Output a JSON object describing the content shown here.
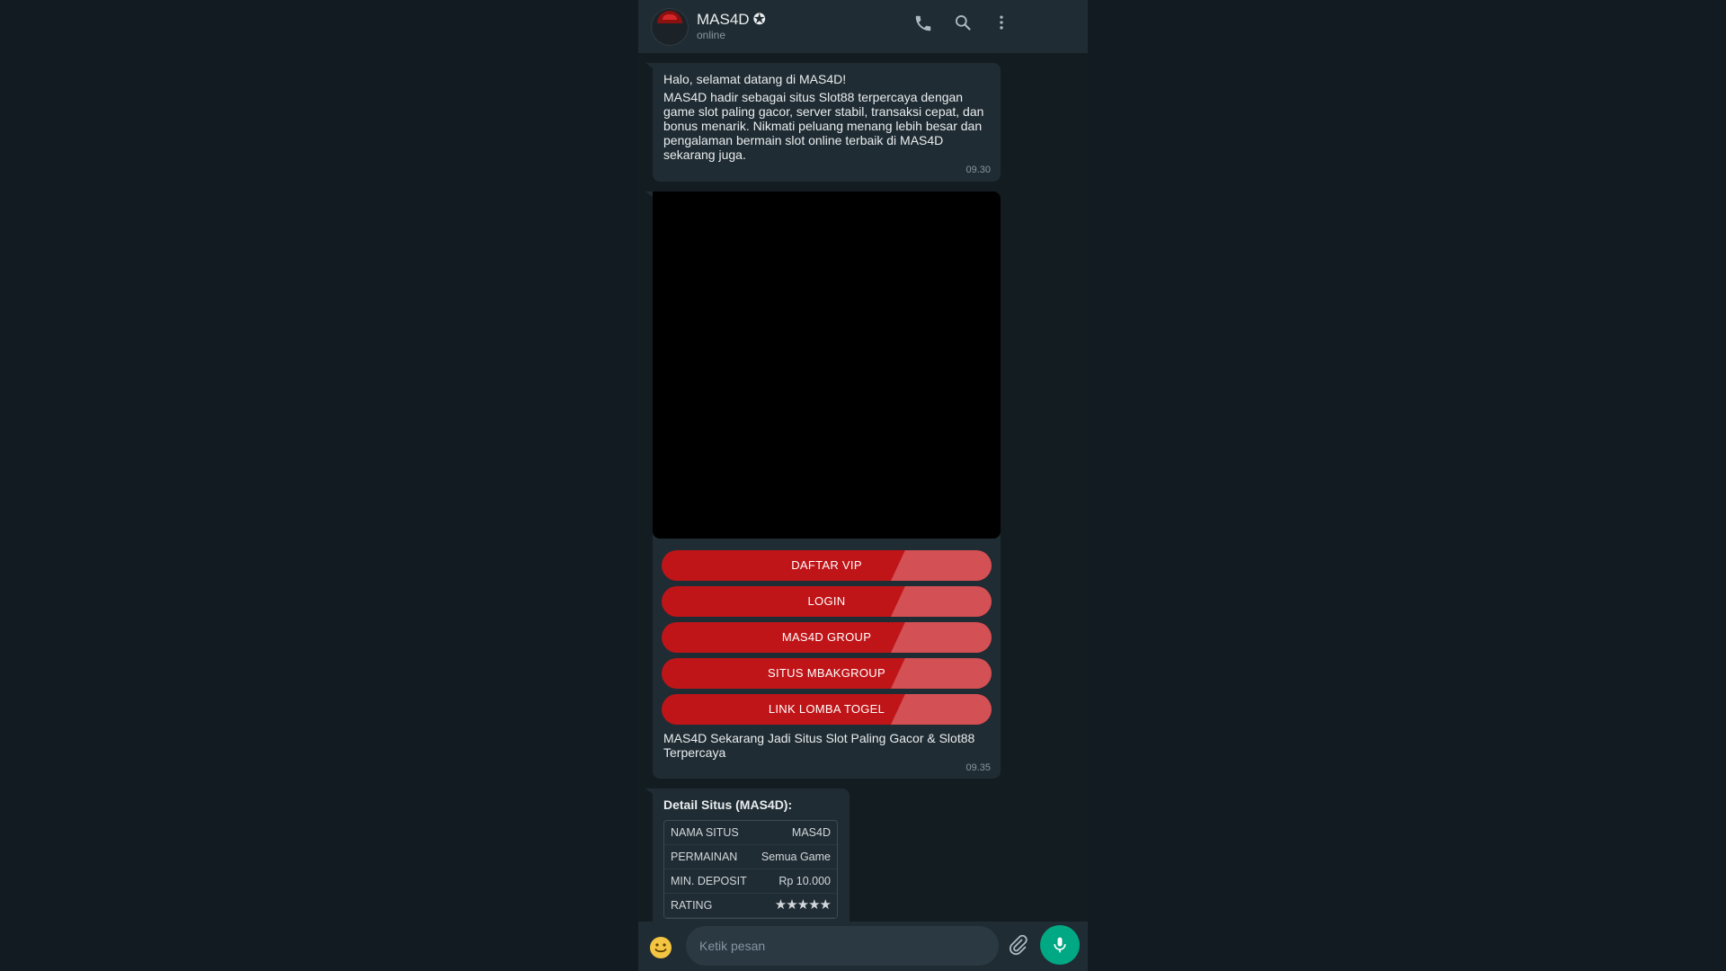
{
  "header": {
    "name": "MAS4D",
    "verified_glyph": "✪",
    "status": "online",
    "icons": [
      "phone-icon",
      "search-icon",
      "more-options-icon"
    ]
  },
  "messages": {
    "welcome": {
      "greeting": "Halo, selamat datang di MAS4D!",
      "body": "MAS4D hadir sebagai situs Slot88 terpercaya dengan game slot paling gacor, server stabil, transaksi cepat, dan bonus menarik. Nikmati peluang menang lebih besar dan pengalaman bermain slot online terbaik di MAS4D sekarang juga.",
      "time": "09.30"
    },
    "media": {
      "buttons": [
        "DAFTAR VIP",
        "LOGIN",
        "MAS4D GROUP",
        "SITUS MBAKGROUP",
        "LINK LOMBA TOGEL"
      ],
      "caption": "MAS4D Sekarang Jadi Situs Slot Paling Gacor & Slot88 Terpercaya",
      "time": "09.35"
    },
    "detail": {
      "title": "Detail Situs (MAS4D):",
      "rows": [
        {
          "key": "NAMA SITUS",
          "value": "MAS4D"
        },
        {
          "key": "PERMAINAN",
          "value": "Semua Game"
        },
        {
          "key": "MIN. DEPOSIT",
          "value": "Rp 10.000"
        },
        {
          "key": "RATING",
          "value": "★★★★★"
        }
      ],
      "rating_stars": 5
    }
  },
  "footer": {
    "placeholder": "Ketik pesan",
    "icons": [
      "emoji-icon",
      "attach-icon",
      "microphone-icon"
    ]
  },
  "colors": {
    "background": "#111b21",
    "bubble": "#202c33",
    "button_red": "#c01518",
    "accent_green": "#00a884",
    "star_gold": "#d9b44a"
  }
}
